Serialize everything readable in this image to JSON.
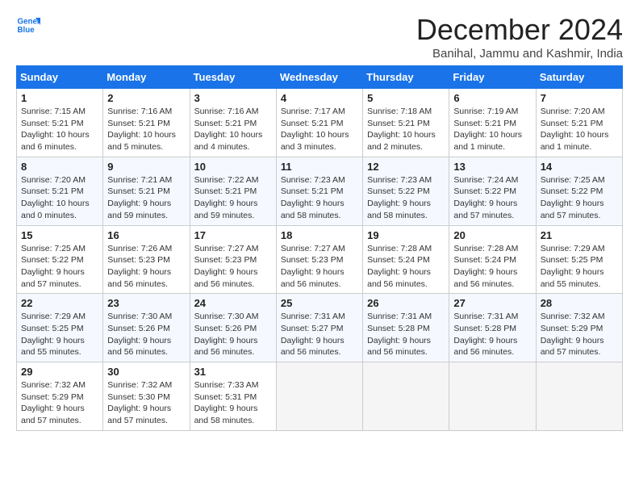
{
  "logo": {
    "line1": "General",
    "line2": "Blue"
  },
  "title": "December 2024",
  "subtitle": "Banihal, Jammu and Kashmir, India",
  "headers": [
    "Sunday",
    "Monday",
    "Tuesday",
    "Wednesday",
    "Thursday",
    "Friday",
    "Saturday"
  ],
  "weeks": [
    [
      {
        "day": "1",
        "info": "Sunrise: 7:15 AM\nSunset: 5:21 PM\nDaylight: 10 hours and 6 minutes."
      },
      {
        "day": "2",
        "info": "Sunrise: 7:16 AM\nSunset: 5:21 PM\nDaylight: 10 hours and 5 minutes."
      },
      {
        "day": "3",
        "info": "Sunrise: 7:16 AM\nSunset: 5:21 PM\nDaylight: 10 hours and 4 minutes."
      },
      {
        "day": "4",
        "info": "Sunrise: 7:17 AM\nSunset: 5:21 PM\nDaylight: 10 hours and 3 minutes."
      },
      {
        "day": "5",
        "info": "Sunrise: 7:18 AM\nSunset: 5:21 PM\nDaylight: 10 hours and 2 minutes."
      },
      {
        "day": "6",
        "info": "Sunrise: 7:19 AM\nSunset: 5:21 PM\nDaylight: 10 hours and 1 minute."
      },
      {
        "day": "7",
        "info": "Sunrise: 7:20 AM\nSunset: 5:21 PM\nDaylight: 10 hours and 1 minute."
      }
    ],
    [
      {
        "day": "8",
        "info": "Sunrise: 7:20 AM\nSunset: 5:21 PM\nDaylight: 10 hours and 0 minutes."
      },
      {
        "day": "9",
        "info": "Sunrise: 7:21 AM\nSunset: 5:21 PM\nDaylight: 9 hours and 59 minutes."
      },
      {
        "day": "10",
        "info": "Sunrise: 7:22 AM\nSunset: 5:21 PM\nDaylight: 9 hours and 59 minutes."
      },
      {
        "day": "11",
        "info": "Sunrise: 7:23 AM\nSunset: 5:21 PM\nDaylight: 9 hours and 58 minutes."
      },
      {
        "day": "12",
        "info": "Sunrise: 7:23 AM\nSunset: 5:22 PM\nDaylight: 9 hours and 58 minutes."
      },
      {
        "day": "13",
        "info": "Sunrise: 7:24 AM\nSunset: 5:22 PM\nDaylight: 9 hours and 57 minutes."
      },
      {
        "day": "14",
        "info": "Sunrise: 7:25 AM\nSunset: 5:22 PM\nDaylight: 9 hours and 57 minutes."
      }
    ],
    [
      {
        "day": "15",
        "info": "Sunrise: 7:25 AM\nSunset: 5:22 PM\nDaylight: 9 hours and 57 minutes."
      },
      {
        "day": "16",
        "info": "Sunrise: 7:26 AM\nSunset: 5:23 PM\nDaylight: 9 hours and 56 minutes."
      },
      {
        "day": "17",
        "info": "Sunrise: 7:27 AM\nSunset: 5:23 PM\nDaylight: 9 hours and 56 minutes."
      },
      {
        "day": "18",
        "info": "Sunrise: 7:27 AM\nSunset: 5:23 PM\nDaylight: 9 hours and 56 minutes."
      },
      {
        "day": "19",
        "info": "Sunrise: 7:28 AM\nSunset: 5:24 PM\nDaylight: 9 hours and 56 minutes."
      },
      {
        "day": "20",
        "info": "Sunrise: 7:28 AM\nSunset: 5:24 PM\nDaylight: 9 hours and 56 minutes."
      },
      {
        "day": "21",
        "info": "Sunrise: 7:29 AM\nSunset: 5:25 PM\nDaylight: 9 hours and 55 minutes."
      }
    ],
    [
      {
        "day": "22",
        "info": "Sunrise: 7:29 AM\nSunset: 5:25 PM\nDaylight: 9 hours and 55 minutes."
      },
      {
        "day": "23",
        "info": "Sunrise: 7:30 AM\nSunset: 5:26 PM\nDaylight: 9 hours and 56 minutes."
      },
      {
        "day": "24",
        "info": "Sunrise: 7:30 AM\nSunset: 5:26 PM\nDaylight: 9 hours and 56 minutes."
      },
      {
        "day": "25",
        "info": "Sunrise: 7:31 AM\nSunset: 5:27 PM\nDaylight: 9 hours and 56 minutes."
      },
      {
        "day": "26",
        "info": "Sunrise: 7:31 AM\nSunset: 5:28 PM\nDaylight: 9 hours and 56 minutes."
      },
      {
        "day": "27",
        "info": "Sunrise: 7:31 AM\nSunset: 5:28 PM\nDaylight: 9 hours and 56 minutes."
      },
      {
        "day": "28",
        "info": "Sunrise: 7:32 AM\nSunset: 5:29 PM\nDaylight: 9 hours and 57 minutes."
      }
    ],
    [
      {
        "day": "29",
        "info": "Sunrise: 7:32 AM\nSunset: 5:29 PM\nDaylight: 9 hours and 57 minutes."
      },
      {
        "day": "30",
        "info": "Sunrise: 7:32 AM\nSunset: 5:30 PM\nDaylight: 9 hours and 57 minutes."
      },
      {
        "day": "31",
        "info": "Sunrise: 7:33 AM\nSunset: 5:31 PM\nDaylight: 9 hours and 58 minutes."
      },
      {
        "day": "",
        "info": ""
      },
      {
        "day": "",
        "info": ""
      },
      {
        "day": "",
        "info": ""
      },
      {
        "day": "",
        "info": ""
      }
    ]
  ]
}
